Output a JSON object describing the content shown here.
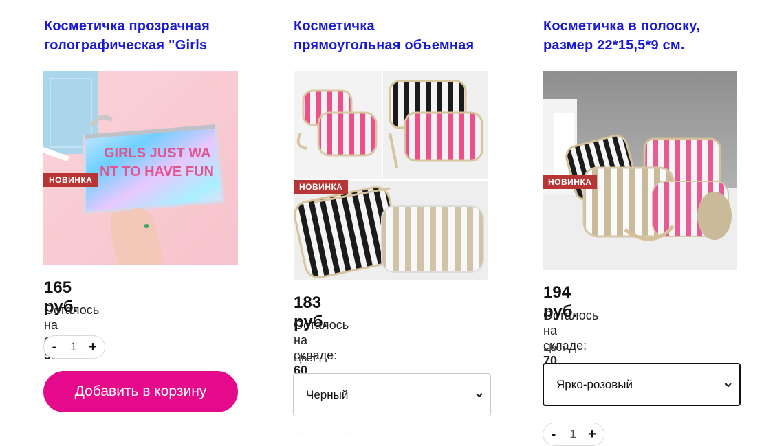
{
  "products": [
    {
      "title_line1": "Косметичка прозрачная",
      "title_line2": "голографическая \"Girls",
      "badge": "НОВИНКА",
      "image_text_line1": "GIRLS JUST WA",
      "image_text_line2": "NT TO HAVE FUN",
      "price": "165 руб.",
      "stock_label": "Осталось на складе: ",
      "stock_value": "50",
      "qty_minus": "-",
      "qty_value": "1",
      "qty_plus": "+",
      "add_button": "Добавить в корзину"
    },
    {
      "title_line1": "Косметичка",
      "title_line2": "прямоугольная объемная",
      "badge": "НОВИНКА",
      "price": "183 руб.",
      "stock_label": "Осталось на складе: ",
      "stock_value": "60",
      "color_label": "Цвет",
      "color_selected": "Черный"
    },
    {
      "title_line1": "Косметичка в полоску,",
      "title_line2": "размер 22*15,5*9 см.",
      "badge": "НОВИНКА",
      "price": "194 руб.",
      "stock_label": "Осталось на складе: ",
      "stock_value": "70",
      "color_label": "Цвет",
      "color_selected": "Ярко-розовый",
      "qty_minus": "-",
      "qty_value": "1",
      "qty_plus": "+"
    }
  ],
  "colors": {
    "title": "#1a1ad6",
    "badge": "#b73535",
    "add_button": "#e5098c"
  }
}
